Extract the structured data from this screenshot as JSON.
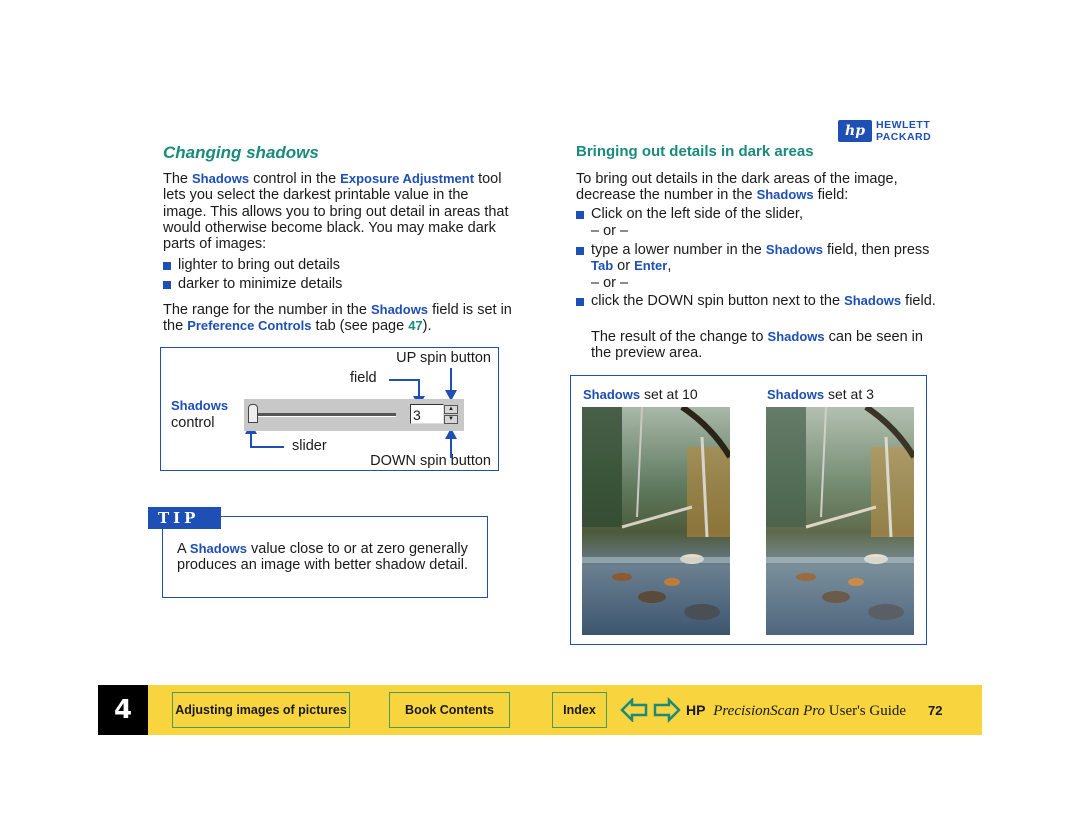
{
  "logo": {
    "mark": "hp",
    "line1": "HEWLETT",
    "line2": "PACKARD"
  },
  "left": {
    "title": "Changing shadows",
    "intro": [
      {
        "t": "The "
      },
      {
        "t": "Shadows",
        "b": 1
      },
      {
        "t": " control in the "
      },
      {
        "t": "Exposure Adjustment",
        "b": 1
      },
      {
        "t": " tool lets you select the darkest printable value in the image. This allows you to bring out detail in areas that would otherwise become black. You may make dark parts of images:"
      }
    ],
    "bullets": [
      "lighter to bring out details",
      "darker to minimize details"
    ],
    "range": [
      {
        "t": "The range for the number in the "
      },
      {
        "t": "Shadows",
        "b": 1
      },
      {
        "t": " field is set in the "
      },
      {
        "t": "Preference Controls",
        "b": 1
      },
      {
        "t": " tab (see page "
      },
      {
        "t": "47",
        "g": 1
      },
      {
        "t": ")."
      }
    ]
  },
  "diagram": {
    "up_label": "UP spin button",
    "field_label": "field",
    "shadows_label": "Shadows",
    "control_label": "control",
    "slider_label": "slider",
    "down_label": "DOWN spin button",
    "field_value": "3",
    "slider_position": 0.0,
    "spin_up": "▲",
    "spin_down": "▼"
  },
  "tip": {
    "label": "TIP",
    "text": [
      {
        "t": "A "
      },
      {
        "t": "Shadows",
        "b": 1
      },
      {
        "t": " value close to or at zero generally produces an image with better shadow detail."
      }
    ]
  },
  "right": {
    "title": "Bringing out details in dark areas",
    "intro": [
      {
        "t": "To bring out details in the dark areas of the image, decrease the number in the "
      },
      {
        "t": "Shadows",
        "b": 1
      },
      {
        "t": " field:"
      }
    ],
    "steps": [
      [
        {
          "t": "Click on the left side of the slider,"
        }
      ],
      [
        {
          "t": "type a lower number in the "
        },
        {
          "t": "Shadows",
          "b": 1
        },
        {
          "t": " field, then press "
        },
        {
          "t": "Tab",
          "b": 1
        },
        {
          "t": " or "
        },
        {
          "t": "Enter",
          "b": 1
        },
        {
          "t": ","
        }
      ],
      [
        {
          "t": "click the DOWN spin button next to the "
        },
        {
          "t": "Shadows",
          "b": 1
        },
        {
          "t": " field."
        }
      ]
    ],
    "or_text": "– or –",
    "result": [
      {
        "t": "The result of the change to "
      },
      {
        "t": "Shadows",
        "b": 1
      },
      {
        "t": " can be seen in the preview area."
      }
    ]
  },
  "preview": {
    "captions": [
      {
        "keyword": "Shadows",
        "rest": " set at 10"
      },
      {
        "keyword": "Shadows",
        "rest": " set at 3"
      }
    ],
    "images": [
      "forest-stream-shadows-10",
      "forest-stream-shadows-3"
    ]
  },
  "footer": {
    "chapter": "4",
    "chapter_button": "Adjusting images of pictures",
    "contents_button": "Book Contents",
    "index_button": "Index",
    "back_icon": "back-arrow-icon",
    "forward_icon": "forward-arrow-icon",
    "brand": "HP",
    "product": "PrecisionScan Pro",
    "guide": " User's Guide",
    "page": "72"
  },
  "colors": {
    "accent_blue": "#1e4fb4",
    "teal": "#1a8a7c",
    "footer_yellow": "#f8d53f",
    "button_border": "#4a9b5c"
  }
}
